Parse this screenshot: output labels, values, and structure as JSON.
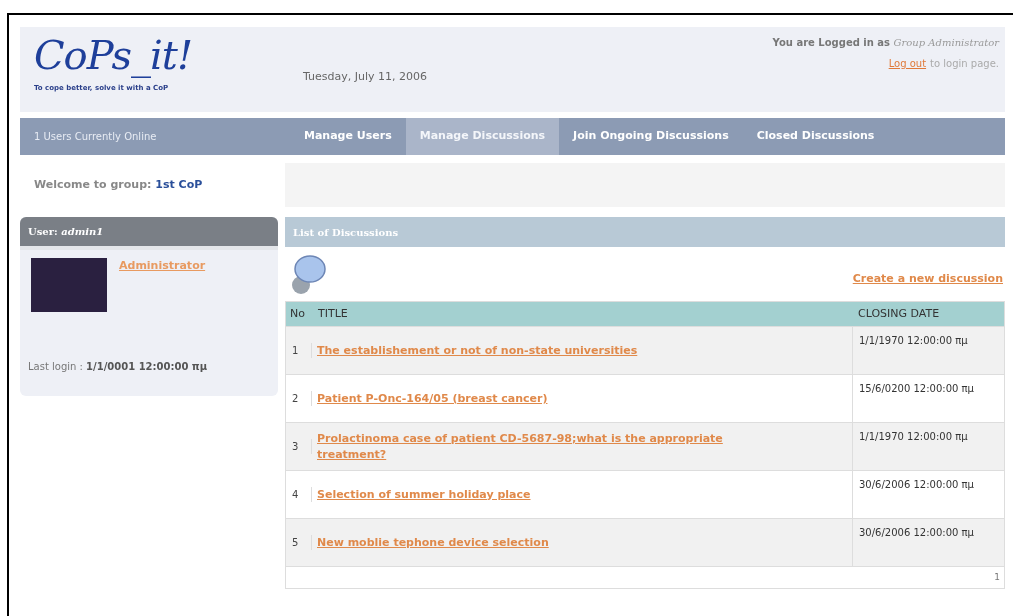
{
  "logo": {
    "text": "CoPs_it!",
    "tagline": "To cope better, solve it with a CoP"
  },
  "header": {
    "date": "Tuesday, July 11, 2006",
    "login_prefix": "You are Logged in as",
    "role": "Group Administrator",
    "logout_link": "Log out",
    "logout_suffix": "to login page."
  },
  "nav": {
    "online": "1 Users Currently Online",
    "tabs": [
      {
        "label": "Manage Users",
        "selected": false
      },
      {
        "label": "Manage Discussions",
        "selected": true
      },
      {
        "label": "Join Ongoing Discussions",
        "selected": false
      },
      {
        "label": "Closed Discussions",
        "selected": false
      }
    ]
  },
  "welcome": {
    "label": "Welcome to group:",
    "group": "1st CoP"
  },
  "user_panel": {
    "title_prefix": "User:",
    "username": "admin1",
    "name_link": "Administrator",
    "last_login_label": "Last login :",
    "last_login": "1/1/0001 12:00:00 πμ"
  },
  "discussions": {
    "title": "List of Discussions",
    "create_link": "Create a new discussion",
    "columns": [
      "No",
      "TITLE",
      "CLOSING DATE"
    ],
    "rows": [
      {
        "no": "1",
        "title": "The establishement or not of non-state universities",
        "closing_date": "1/1/1970 12:00:00 πμ"
      },
      {
        "no": "2",
        "title": "Patient P-Onc-164/05 (breast cancer)",
        "closing_date": "15/6/0200 12:00:00 πμ"
      },
      {
        "no": "3",
        "title": "Prolactinoma case of patient CD-5687-98;what is the appropriate treatment?",
        "closing_date": "1/1/1970 12:00:00 πμ"
      },
      {
        "no": "4",
        "title": "Selection of summer holiday place",
        "closing_date": "30/6/2006 12:00:00 πμ"
      },
      {
        "no": "5",
        "title": "New moblie tephone device selection",
        "closing_date": "30/6/2006 12:00:00 πμ"
      }
    ],
    "pager": "1"
  }
}
